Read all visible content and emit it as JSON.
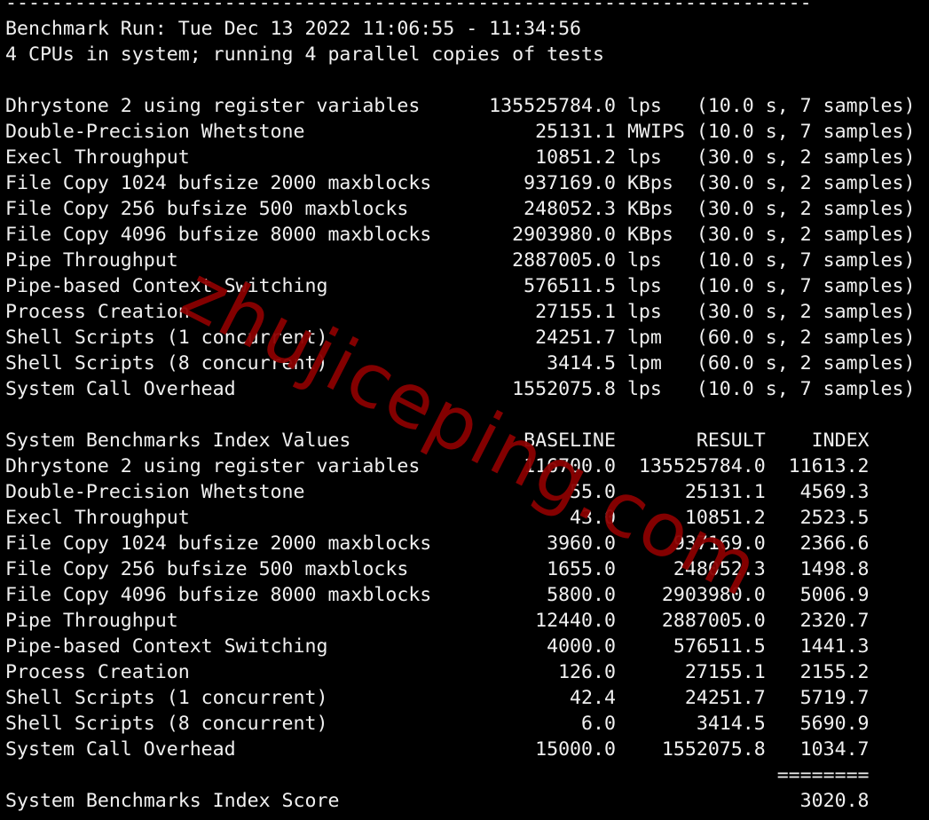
{
  "separator": "----------------------------------------------------------------------",
  "header": {
    "run_line": "Benchmark Run: Tue Dec 13 2022 11:06:55 - 11:34:56",
    "cpu_line": "4 CPUs in system; running 4 parallel copies of tests"
  },
  "results": [
    {
      "name": "Dhrystone 2 using register variables",
      "value": "135525784.0",
      "unit": "lps",
      "meta": "(10.0 s, 7 samples)"
    },
    {
      "name": "Double-Precision Whetstone",
      "value": "25131.1",
      "unit": "MWIPS",
      "meta": "(10.0 s, 7 samples)"
    },
    {
      "name": "Execl Throughput",
      "value": "10851.2",
      "unit": "lps",
      "meta": "(30.0 s, 2 samples)"
    },
    {
      "name": "File Copy 1024 bufsize 2000 maxblocks",
      "value": "937169.0",
      "unit": "KBps",
      "meta": "(30.0 s, 2 samples)"
    },
    {
      "name": "File Copy 256 bufsize 500 maxblocks",
      "value": "248052.3",
      "unit": "KBps",
      "meta": "(30.0 s, 2 samples)"
    },
    {
      "name": "File Copy 4096 bufsize 8000 maxblocks",
      "value": "2903980.0",
      "unit": "KBps",
      "meta": "(30.0 s, 2 samples)"
    },
    {
      "name": "Pipe Throughput",
      "value": "2887005.0",
      "unit": "lps",
      "meta": "(10.0 s, 7 samples)"
    },
    {
      "name": "Pipe-based Context Switching",
      "value": "576511.5",
      "unit": "lps",
      "meta": "(10.0 s, 7 samples)"
    },
    {
      "name": "Process Creation",
      "value": "27155.1",
      "unit": "lps",
      "meta": "(30.0 s, 2 samples)"
    },
    {
      "name": "Shell Scripts (1 concurrent)",
      "value": "24251.7",
      "unit": "lpm",
      "meta": "(60.0 s, 2 samples)"
    },
    {
      "name": "Shell Scripts (8 concurrent)",
      "value": "3414.5",
      "unit": "lpm",
      "meta": "(60.0 s, 2 samples)"
    },
    {
      "name": "System Call Overhead",
      "value": "1552075.8",
      "unit": "lps",
      "meta": "(10.0 s, 7 samples)"
    }
  ],
  "index": {
    "title": "System Benchmarks Index Values",
    "columns": [
      "BASELINE",
      "RESULT",
      "INDEX"
    ],
    "rows": [
      {
        "name": "Dhrystone 2 using register variables",
        "baseline": "116700.0",
        "result": "135525784.0",
        "index": "11613.2"
      },
      {
        "name": "Double-Precision Whetstone",
        "baseline": "55.0",
        "result": "25131.1",
        "index": "4569.3"
      },
      {
        "name": "Execl Throughput",
        "baseline": "43.0",
        "result": "10851.2",
        "index": "2523.5"
      },
      {
        "name": "File Copy 1024 bufsize 2000 maxblocks",
        "baseline": "3960.0",
        "result": "937169.0",
        "index": "2366.6"
      },
      {
        "name": "File Copy 256 bufsize 500 maxblocks",
        "baseline": "1655.0",
        "result": "248052.3",
        "index": "1498.8"
      },
      {
        "name": "File Copy 4096 bufsize 8000 maxblocks",
        "baseline": "5800.0",
        "result": "2903980.0",
        "index": "5006.9"
      },
      {
        "name": "Pipe Throughput",
        "baseline": "12440.0",
        "result": "2887005.0",
        "index": "2320.7"
      },
      {
        "name": "Pipe-based Context Switching",
        "baseline": "4000.0",
        "result": "576511.5",
        "index": "1441.3"
      },
      {
        "name": "Process Creation",
        "baseline": "126.0",
        "result": "27155.1",
        "index": "2155.2"
      },
      {
        "name": "Shell Scripts (1 concurrent)",
        "baseline": "42.4",
        "result": "24251.7",
        "index": "5719.7"
      },
      {
        "name": "Shell Scripts (8 concurrent)",
        "baseline": "6.0",
        "result": "3414.5",
        "index": "5690.9"
      },
      {
        "name": "System Call Overhead",
        "baseline": "15000.0",
        "result": "1552075.8",
        "index": "1034.7"
      }
    ],
    "rule": "========",
    "score_label": "System Benchmarks Index Score",
    "score": "3020.8"
  },
  "watermark": {
    "text": "zhujiceping.com",
    "color": "#8b0000"
  }
}
